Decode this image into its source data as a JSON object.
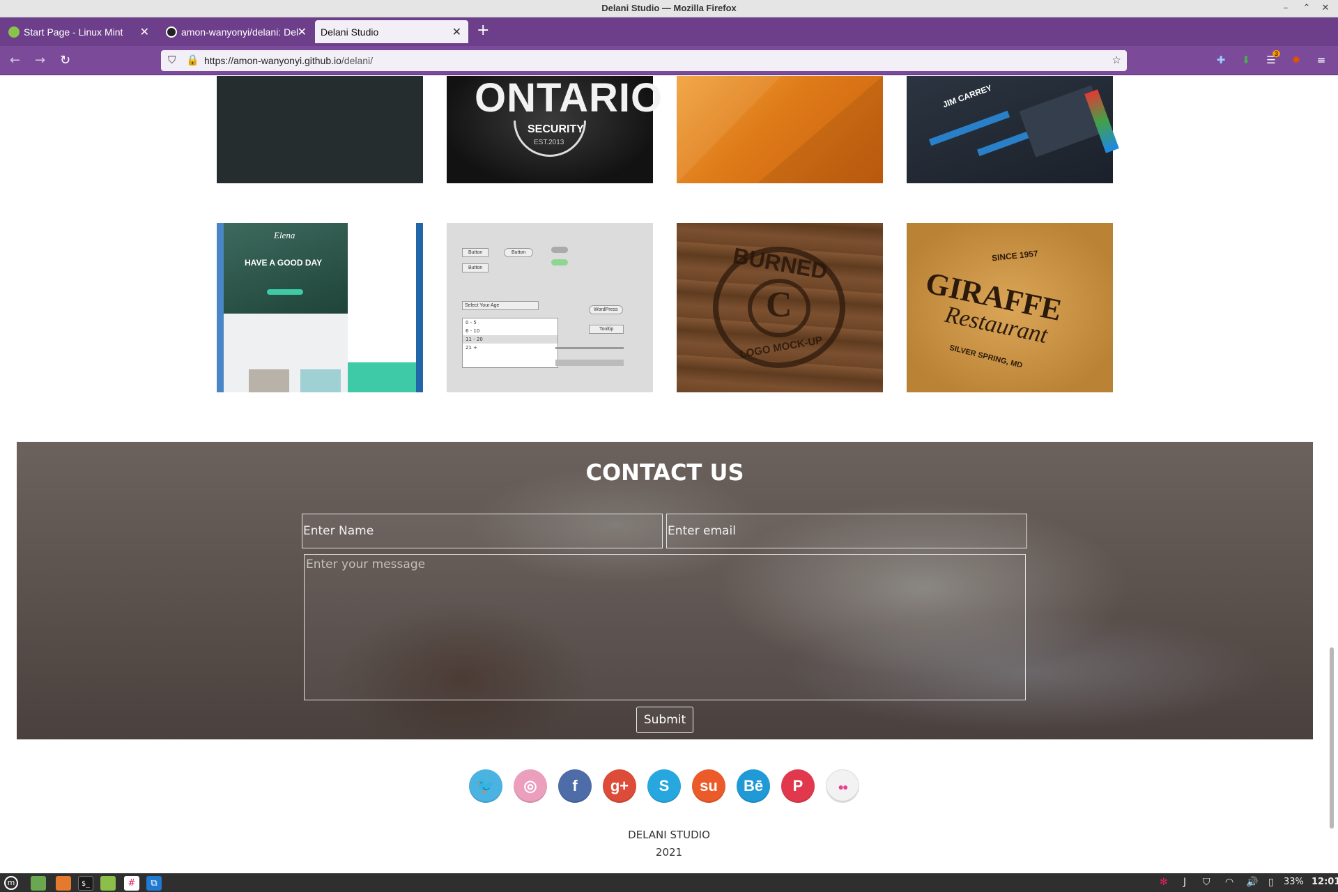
{
  "window": {
    "title": "Delani Studio — Mozilla Firefox",
    "controls": [
      "–",
      "⌃",
      "✕"
    ]
  },
  "tabs": [
    {
      "label": "Start Page - Linux Mint",
      "icon": "linux-mint-icon",
      "active": false
    },
    {
      "label": "amon-wanyonyi/delani: Del",
      "icon": "github-icon",
      "active": false
    },
    {
      "label": "Delani Studio",
      "icon": "",
      "active": true
    }
  ],
  "toolbar": {
    "back": "←",
    "forward": "→",
    "reload": "↻",
    "url_prefix": "https://amon-wanyonyi.",
    "url_domain": "github.io",
    "url_path": "/delani/",
    "extensions_badge": "3"
  },
  "portfolio": {
    "row1": [
      {
        "name": "dark-slate",
        "color": "#262d2f"
      },
      {
        "name": "ontario-security",
        "text": "ONTARIO",
        "sub": "SECURITY",
        "year": "EST.2013"
      },
      {
        "name": "orange-polygons",
        "color": "#e07e1e"
      },
      {
        "name": "dashboard-ui",
        "text": "JIM CARREY"
      }
    ],
    "row2": [
      {
        "name": "elena-website",
        "text": "HAVE A GOOD DAY",
        "brand": "Elena"
      },
      {
        "name": "ui-kit",
        "labels": [
          "Button",
          "Button",
          "Button",
          "Select Your Age",
          "0 - 5",
          "6 - 10",
          "11 - 20",
          "21 +",
          "WordPress",
          "Tooltip"
        ]
      },
      {
        "name": "burned-logo",
        "text": "BURNED",
        "sub": "LOGO MOCK-UP",
        "letter": "C"
      },
      {
        "name": "giraffe-restaurant",
        "text": "GIRAFFE",
        "sub": "Restaurant",
        "top": "SINCE 1957",
        "bottom": "SILVER SPRING, MD"
      }
    ]
  },
  "contact": {
    "heading": "CONTACT US",
    "name_placeholder": "Enter Name",
    "email_placeholder": "Enter email",
    "message_placeholder": "Enter your message",
    "submit_label": "Submit"
  },
  "social": [
    {
      "name": "twitter-icon",
      "glyph": "🐦",
      "color": "#4ab3e2"
    },
    {
      "name": "dribbble-icon",
      "glyph": "◎",
      "color": "#ec9ebd"
    },
    {
      "name": "facebook-icon",
      "glyph": "f",
      "color": "#4d6ca8"
    },
    {
      "name": "google-plus-icon",
      "glyph": "g+",
      "color": "#dd4b39"
    },
    {
      "name": "skype-icon",
      "glyph": "S",
      "color": "#27a7e0"
    },
    {
      "name": "stumbleupon-icon",
      "glyph": "su",
      "color": "#eb5b29"
    },
    {
      "name": "behance-icon",
      "glyph": "Bē",
      "color": "#1f9ad6"
    },
    {
      "name": "pinterest-icon",
      "glyph": "P",
      "color": "#e2384d"
    },
    {
      "name": "flickr-icon",
      "glyph": "●●",
      "color": "#f2f2f2"
    }
  ],
  "footer": {
    "line1": "DELANI STUDIO",
    "line2": "2021"
  },
  "taskbar": {
    "battery": "33%",
    "clock": "12:01"
  }
}
